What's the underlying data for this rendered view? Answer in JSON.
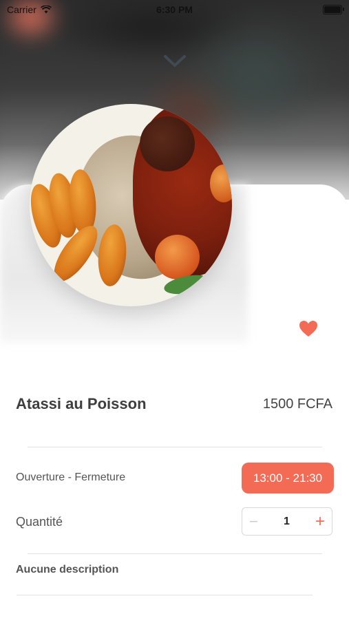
{
  "status_bar": {
    "carrier": "Carrier",
    "time": "6:30 PM"
  },
  "dish": {
    "name": "Atassi au Poisson",
    "price": "1500 FCFA"
  },
  "hours": {
    "label": "Ouverture - Fermeture",
    "value": "13:00 - 21:30"
  },
  "quantity": {
    "label": "Quantité",
    "value": "1",
    "minus": "−",
    "plus": "+"
  },
  "description": "Aucune description",
  "colors": {
    "accent": "#f46b55",
    "text": "#3e3e3e"
  },
  "icons": {
    "close": "chevron-down-icon",
    "favorite": "heart-icon"
  }
}
